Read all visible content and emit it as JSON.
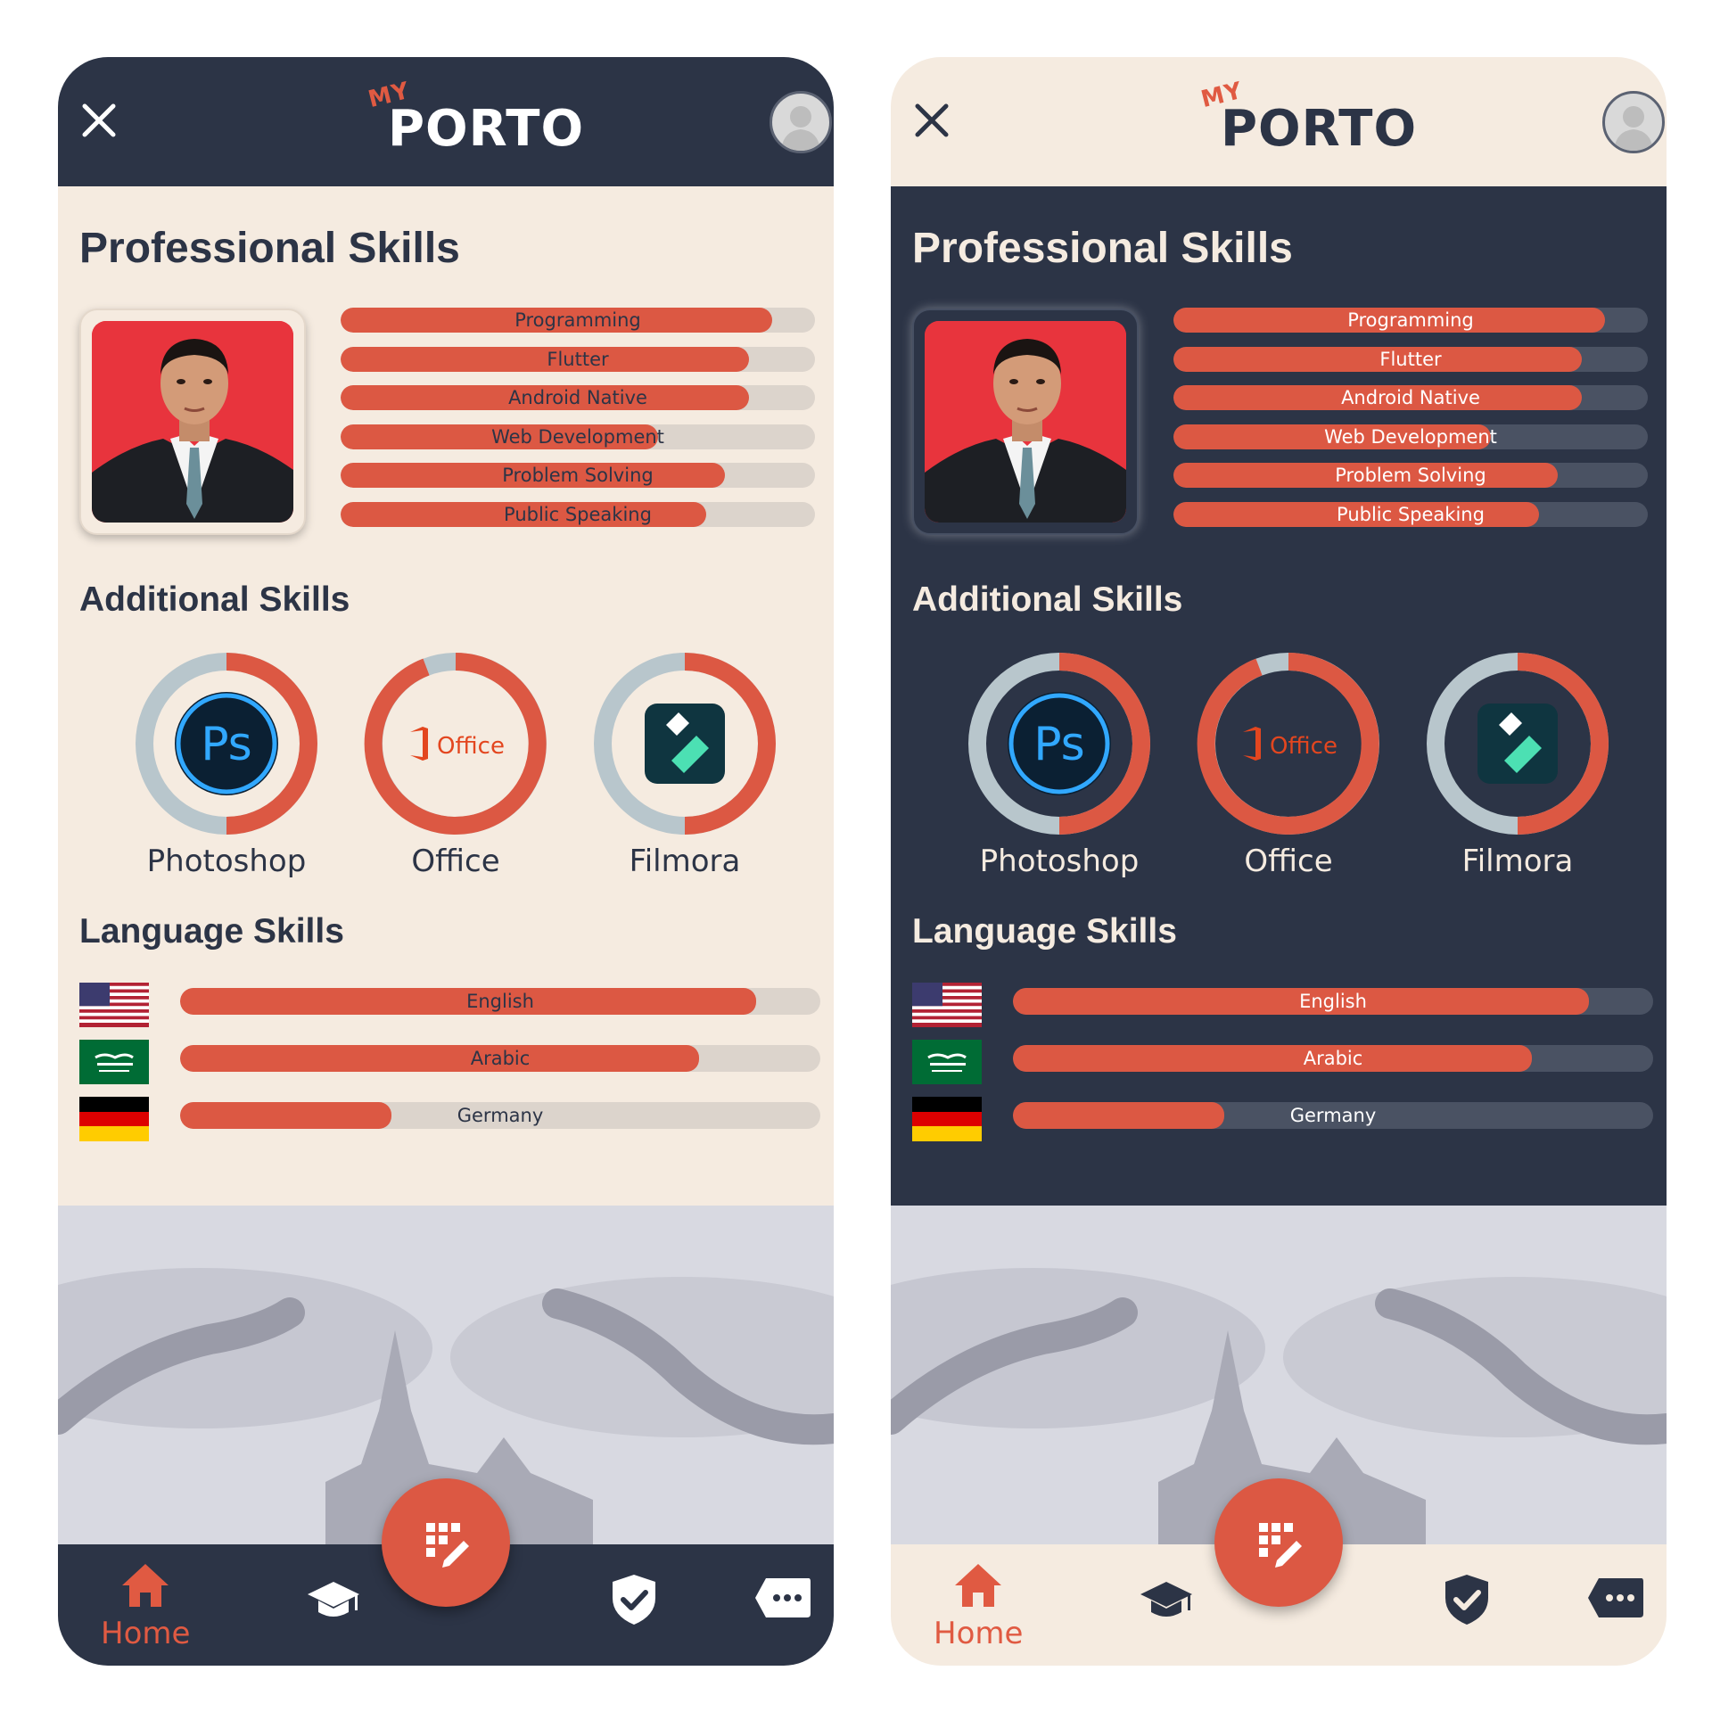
{
  "app": {
    "logo_small": "MY",
    "logo_main": "PORTO"
  },
  "professional": {
    "title": "Professional Skills",
    "skills": [
      {
        "name": "Programming",
        "level": 0.91
      },
      {
        "name": "Flutter",
        "level": 0.86
      },
      {
        "name": "Android Native",
        "level": 0.86
      },
      {
        "name": "Web Development",
        "level": 0.67
      },
      {
        "name": "Problem Solving",
        "level": 0.81
      },
      {
        "name": "Public Speaking",
        "level": 0.77
      }
    ]
  },
  "additional": {
    "title": "Additional Skills",
    "skills": [
      {
        "name": "Photoshop",
        "level": 0.5,
        "icon": "photoshop-icon"
      },
      {
        "name": "Office",
        "level": 0.93,
        "icon": "office-icon",
        "icon_text": "Office"
      },
      {
        "name": "Filmora",
        "level": 0.5,
        "icon": "filmora-icon"
      }
    ]
  },
  "language": {
    "title": "Language Skills",
    "skills": [
      {
        "name": "English",
        "level": 0.9,
        "flag": "us-flag"
      },
      {
        "name": "Arabic",
        "level": 0.81,
        "flag": "saudi-flag"
      },
      {
        "name": "Germany",
        "level": 0.33,
        "flag": "germany-flag"
      }
    ]
  },
  "nav": {
    "home": "Home"
  },
  "icons": {
    "photoshop_text": "Ps"
  },
  "colors": {
    "accent": "#dc5843",
    "navy": "#2c3446",
    "cream": "#f5ebe0"
  }
}
